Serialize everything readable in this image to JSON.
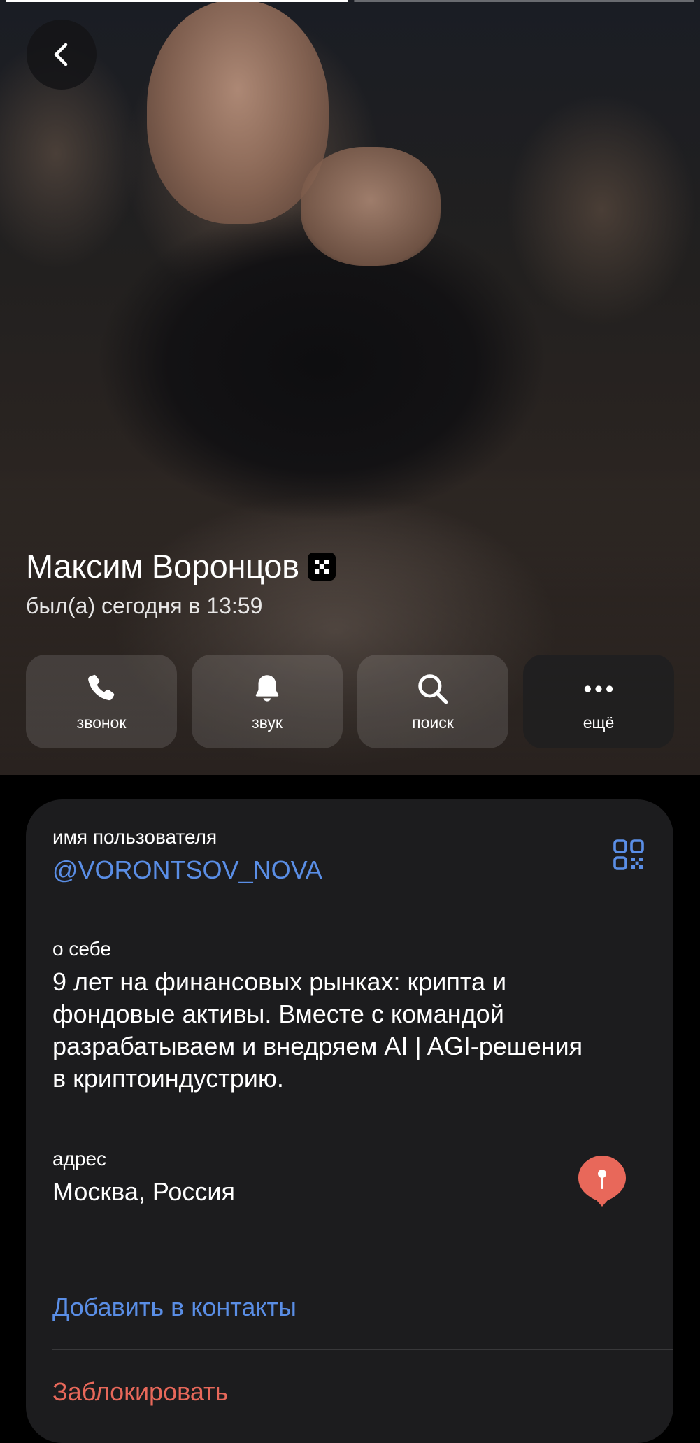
{
  "header": {
    "back_icon": "chevron-left-icon",
    "name": "Максим Воронцов",
    "verified_icon": "emoji-status-icon",
    "status": "был(а) сегодня в 13:59"
  },
  "actions": [
    {
      "label": "звонок",
      "icon": "phone-icon"
    },
    {
      "label": "звук",
      "icon": "bell-icon"
    },
    {
      "label": "поиск",
      "icon": "search-icon"
    },
    {
      "label": "ещё",
      "icon": "more-icon"
    }
  ],
  "info": {
    "username_label": "имя пользователя",
    "username": "@VORONTSOV_NOVA",
    "bio_label": "о себе",
    "bio_lines": [
      "9 лет на финансовых рынках: крипта и",
      "фондовые активы. Вместе с командой",
      "разрабатываем и внедряем AI | AGI-решения",
      "в криптоиндустрию."
    ],
    "address_label": "адрес",
    "address": "Москва, Россия",
    "add_contact": "Добавить в контакты",
    "block": "Заблокировать"
  },
  "colors": {
    "accent": "#5a8ee6",
    "danger": "#e8685a",
    "card": "#1c1c1e",
    "pin": "#e8685a"
  }
}
